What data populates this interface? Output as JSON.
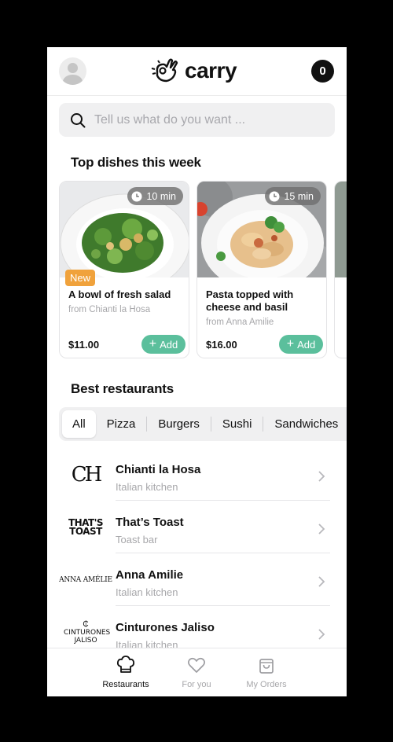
{
  "header": {
    "logo_text": "carry",
    "cart_count": "0"
  },
  "search": {
    "placeholder": "Tell us what do you want ..."
  },
  "sections": {
    "top_dishes": "Top dishes this week",
    "best_restaurants": "Best restaurants"
  },
  "dishes": [
    {
      "name": "A bowl of fresh salad",
      "from": "from Chianti la Hosa",
      "price": "$11.00",
      "time": "10 min",
      "badge": "New",
      "add_label": "Add"
    },
    {
      "name": "Pasta topped with cheese and basil",
      "from": "from Anna Amilie",
      "price": "$16.00",
      "time": "15 min",
      "add_label": "Add"
    }
  ],
  "categories": [
    "All",
    "Pizza",
    "Burgers",
    "Sushi",
    "Sandwiches"
  ],
  "selected_category": "All",
  "restaurants": [
    {
      "name": "Chianti la Hosa",
      "type": "Italian kitchen",
      "logo_text": "CH"
    },
    {
      "name": "That’s Toast",
      "type": "Toast bar",
      "logo_text": "THAT'S TOAST"
    },
    {
      "name": "Anna Amilie",
      "type": "Italian kitchen",
      "logo_text": "ANNA AMÉLIE"
    },
    {
      "name": "Cinturones Jaliso",
      "type": "Italian kitchen",
      "logo_text": "CINTURONES JALISO"
    }
  ],
  "nav": [
    {
      "label": "Restaurants",
      "icon": "chef-hat-icon",
      "active": true
    },
    {
      "label": "For you",
      "icon": "heart-icon",
      "active": false
    },
    {
      "label": "My Orders",
      "icon": "shopping-bag-icon",
      "active": false
    }
  ],
  "colors": {
    "accent_green": "#5bbf9c",
    "badge_orange": "#f0a23c",
    "background": "#000000",
    "text": "#111111"
  }
}
